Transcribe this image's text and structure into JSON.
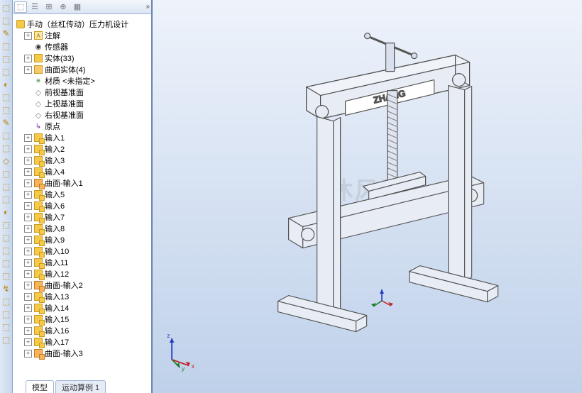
{
  "left_icons": [
    "⬚",
    "⬚",
    "✎",
    "⬚",
    "⬚",
    "⬚",
    "◐",
    "⬚",
    "⬚",
    "✎",
    "⬚",
    "⬚",
    "◇",
    "⬚",
    "⬚",
    "⬚",
    "◐",
    "⬚",
    "⬚",
    "⬚",
    "⬚",
    "⬚",
    "↯",
    "⬚",
    "⬚",
    "⬚",
    "⬚"
  ],
  "panel_tabs": {
    "t1": "⬚",
    "t2": "☰",
    "t3": "⊞",
    "t4": "⊕",
    "t5": "▦",
    "arrow": "»"
  },
  "tree": {
    "root": "手动（丝杠传动）压力机设计",
    "items": [
      {
        "exp": "+",
        "icon": "yellow-a",
        "label": "注解",
        "text_in_icon": "A"
      },
      {
        "exp": "",
        "icon": "sensor",
        "label": "传感器"
      },
      {
        "exp": "+",
        "icon": "solid",
        "label": "实体(33)"
      },
      {
        "exp": "+",
        "icon": "surf",
        "label": "曲面实体(4)"
      },
      {
        "exp": "",
        "icon": "mat",
        "label": "材质 <未指定>"
      },
      {
        "exp": "",
        "icon": "plane",
        "label": "前视基准面"
      },
      {
        "exp": "",
        "icon": "plane",
        "label": "上视基准面"
      },
      {
        "exp": "",
        "icon": "plane",
        "label": "右视基准面"
      },
      {
        "exp": "",
        "icon": "origin",
        "label": "原点"
      },
      {
        "exp": "+",
        "icon": "input",
        "label": "输入1"
      },
      {
        "exp": "+",
        "icon": "input",
        "label": "输入2"
      },
      {
        "exp": "+",
        "icon": "input",
        "label": "输入3"
      },
      {
        "exp": "+",
        "icon": "input",
        "label": "输入4"
      },
      {
        "exp": "+",
        "icon": "surfin",
        "label": "曲面-输入1"
      },
      {
        "exp": "+",
        "icon": "input",
        "label": "输入5"
      },
      {
        "exp": "+",
        "icon": "input",
        "label": "输入6"
      },
      {
        "exp": "+",
        "icon": "input",
        "label": "输入7"
      },
      {
        "exp": "+",
        "icon": "input",
        "label": "输入8"
      },
      {
        "exp": "+",
        "icon": "input",
        "label": "输入9"
      },
      {
        "exp": "+",
        "icon": "input",
        "label": "输入10"
      },
      {
        "exp": "+",
        "icon": "input",
        "label": "输入11"
      },
      {
        "exp": "+",
        "icon": "input",
        "label": "输入12"
      },
      {
        "exp": "+",
        "icon": "surfin",
        "label": "曲面-输入2"
      },
      {
        "exp": "+",
        "icon": "input",
        "label": "输入13"
      },
      {
        "exp": "+",
        "icon": "input",
        "label": "输入14"
      },
      {
        "exp": "+",
        "icon": "input",
        "label": "输入15"
      },
      {
        "exp": "+",
        "icon": "input",
        "label": "输入16"
      },
      {
        "exp": "+",
        "icon": "input",
        "label": "输入17"
      },
      {
        "exp": "+",
        "icon": "surfin",
        "label": "曲面-输入3"
      }
    ]
  },
  "model_brand": "ZHANG",
  "watermark": "沐风网",
  "triad": {
    "x": "x",
    "y": "y",
    "z": "z"
  },
  "bottom_tabs": {
    "t1": "模型",
    "t2": "运动算例 1"
  }
}
